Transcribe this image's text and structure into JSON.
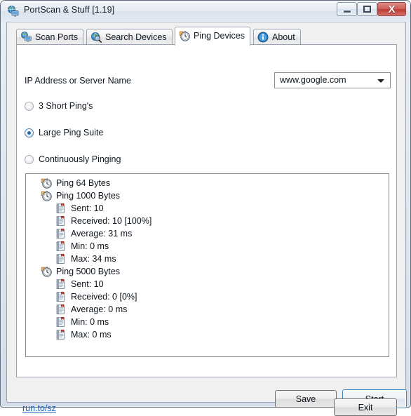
{
  "window": {
    "title": "PortScan & Stuff [1.19]",
    "icon": "app-globe-monitor-icon",
    "controls": {
      "minimize_label": "Minimize",
      "maximize_label": "Maximize",
      "close_label": "Close",
      "close_glyph": "X"
    },
    "colors": {
      "close_button": "#bb3b33",
      "frame_border": "#5d6b7c",
      "client_background": "#f0f0f0",
      "accent_blue": "#3c8ac4",
      "link_blue": "#1c5fb8"
    }
  },
  "tabs": [
    {
      "label": "Scan Ports",
      "icon": "globe-monitor-icon",
      "active": false
    },
    {
      "label": "Search Devices",
      "icon": "globe-magnifier-icon",
      "active": false
    },
    {
      "label": "Ping Devices",
      "icon": "stopwatch-icon",
      "active": true
    },
    {
      "label": "About",
      "icon": "info-circle-icon",
      "active": false
    }
  ],
  "form": {
    "ip_label": "IP Address or Server Name",
    "combo": {
      "value": "www.google.com",
      "placeholder": "www.google.com",
      "arrow_icon": "chevron-down-icon"
    }
  },
  "ping_modes": [
    {
      "label": "3 Short Ping's",
      "selected": false
    },
    {
      "label": "Large Ping Suite",
      "selected": true
    },
    {
      "label": "Continuously Pinging",
      "selected": false
    }
  ],
  "results_tree": [
    {
      "level": 1,
      "icon": "stopwatch-icon",
      "text": "Ping 64 Bytes"
    },
    {
      "level": 1,
      "icon": "stopwatch-icon",
      "text": "Ping 1000 Bytes"
    },
    {
      "level": 2,
      "icon": "document-icon",
      "text": "Sent: 10"
    },
    {
      "level": 2,
      "icon": "document-icon",
      "text": "Received: 10 [100%]"
    },
    {
      "level": 2,
      "icon": "document-icon",
      "text": "Average: 31 ms"
    },
    {
      "level": 2,
      "icon": "document-icon",
      "text": "Min: 0 ms"
    },
    {
      "level": 2,
      "icon": "document-icon",
      "text": "Max: 34 ms"
    },
    {
      "level": 1,
      "icon": "stopwatch-icon",
      "text": "Ping 5000 Bytes"
    },
    {
      "level": 2,
      "icon": "document-icon",
      "text": "Sent: 10"
    },
    {
      "level": 2,
      "icon": "document-icon",
      "text": "Received: 0 [0%]"
    },
    {
      "level": 2,
      "icon": "document-icon",
      "text": "Average: 0 ms"
    },
    {
      "level": 2,
      "icon": "document-icon",
      "text": "Min: 0 ms"
    },
    {
      "level": 2,
      "icon": "document-icon",
      "text": "Max: 0 ms"
    }
  ],
  "buttons": {
    "save": "Save",
    "start": "Start",
    "exit": "Exit"
  },
  "footer": {
    "link_text": "run.to/sz"
  }
}
